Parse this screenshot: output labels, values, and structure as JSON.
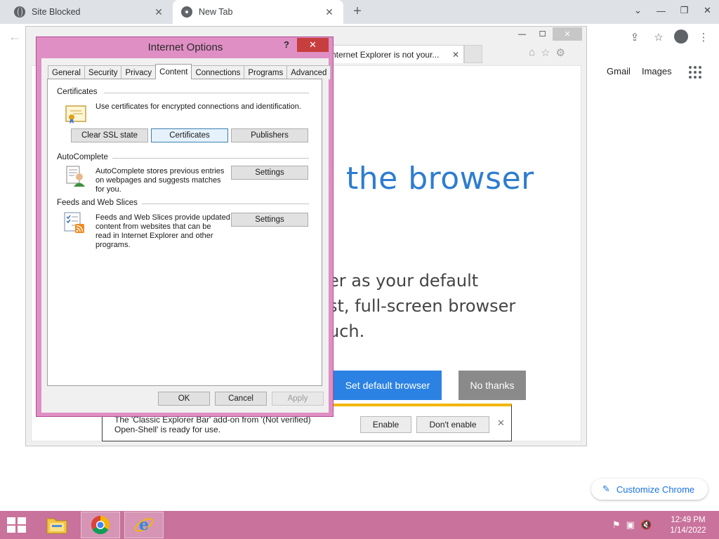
{
  "chrome": {
    "tabs": [
      {
        "title": "Site Blocked",
        "icon": "globe-icon"
      },
      {
        "title": "New Tab",
        "icon": "chrome-icon"
      }
    ],
    "ntp_links": {
      "gmail": "Gmail",
      "images": "Images"
    },
    "customize_label": "Customize Chrome"
  },
  "ie": {
    "tab_title": "nternet Explorer is not your...",
    "heading": "the browser",
    "body_lines": [
      "er as your default",
      "st, full-screen browser",
      "uch."
    ],
    "set_default_label": "Set default browser",
    "no_thanks_label": "No thanks",
    "notification": {
      "line1": "The 'Classic Explorer Bar' add-on from '(Not verified)",
      "line2": "Open-Shell' is ready for use.",
      "enable_label": "Enable",
      "dont_enable_label": "Don't enable"
    }
  },
  "dialog": {
    "title": "Internet Options",
    "help": "?",
    "tabs": [
      "General",
      "Security",
      "Privacy",
      "Content",
      "Connections",
      "Programs",
      "Advanced"
    ],
    "active_tab": "Content",
    "certificates": {
      "label": "Certificates",
      "description": "Use certificates for encrypted connections and identification.",
      "clear_ssl_label": "Clear SSL state",
      "certificates_label": "Certificates",
      "publishers_label": "Publishers"
    },
    "autocomplete": {
      "label": "AutoComplete",
      "description_lines": [
        "AutoComplete stores previous entries",
        "on webpages and suggests matches",
        "for you."
      ],
      "settings_label": "Settings"
    },
    "feeds": {
      "label": "Feeds and Web Slices",
      "description_lines": [
        "Feeds and Web Slices provide updated",
        "content from websites that can be",
        "read in Internet Explorer and other",
        "programs."
      ],
      "settings_label": "Settings"
    },
    "ok_label": "OK",
    "cancel_label": "Cancel",
    "apply_label": "Apply"
  },
  "taskbar": {
    "time": "12:49 PM",
    "date": "1/14/2022"
  },
  "colors": {
    "accent_pink": "#df8fc4",
    "taskbar": "#c8729c",
    "ie_blue": "#2d7cd1",
    "chrome_blue": "#1a73e8"
  }
}
